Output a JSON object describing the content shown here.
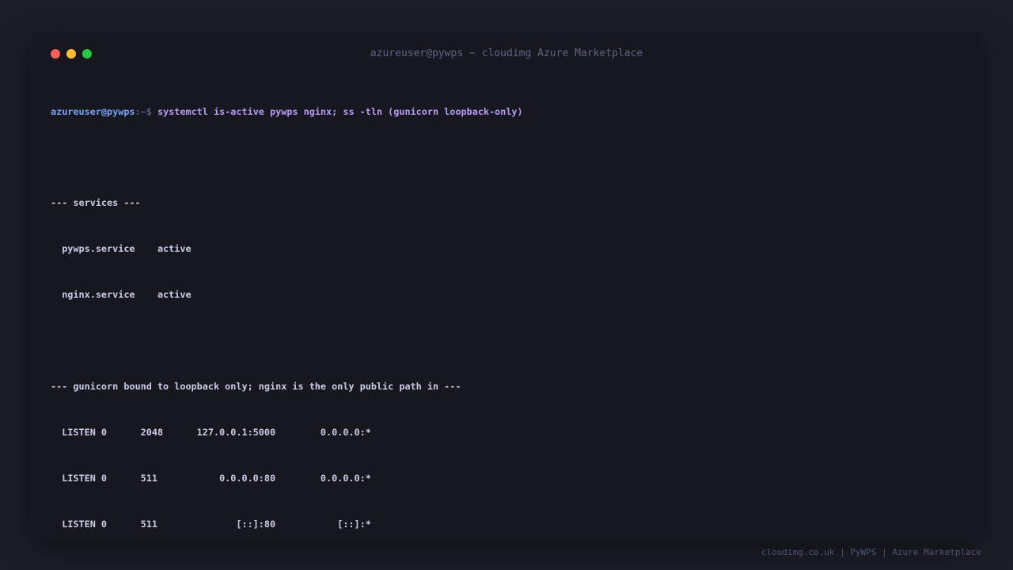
{
  "window": {
    "title": "azureuser@pywps ~ cloudimg Azure Marketplace"
  },
  "terminal": {
    "prompt_user": "azureuser@pywps",
    "prompt_path": ":~$ ",
    "command": "systemctl is-active pywps nginx; ss -tln (gunicorn loopback-only)",
    "services_header": "--- services ---",
    "services": [
      {
        "name": "pywps.service",
        "status": "active"
      },
      {
        "name": "nginx.service",
        "status": "active"
      }
    ],
    "listen_header": "--- gunicorn bound to loopback only; nginx is the only public path in ---",
    "listen_rows": [
      {
        "state": "LISTEN",
        "recvq": "0",
        "sendq": "2048",
        "local": "127.0.0.1:5000",
        "peer": "0.0.0.0:*"
      },
      {
        "state": "LISTEN",
        "recvq": "0",
        "sendq": "511",
        "local": "0.0.0.0:80",
        "peer": "0.0.0.0:*"
      },
      {
        "state": "LISTEN",
        "recvq": "0",
        "sendq": "511",
        "local": "[::]:80",
        "peer": "[::]:*"
      }
    ]
  },
  "footer": {
    "text": "cloudimg.co.uk | PyWPS | Azure Marketplace"
  },
  "colors": {
    "background": "#1c1d26",
    "window": "#16171f",
    "prompt_user": "#7aa2f7",
    "command": "#bb9af7",
    "output": "#c9cde8",
    "close": "#ff5f57",
    "minimize": "#febc2e",
    "maximize": "#28c840"
  }
}
